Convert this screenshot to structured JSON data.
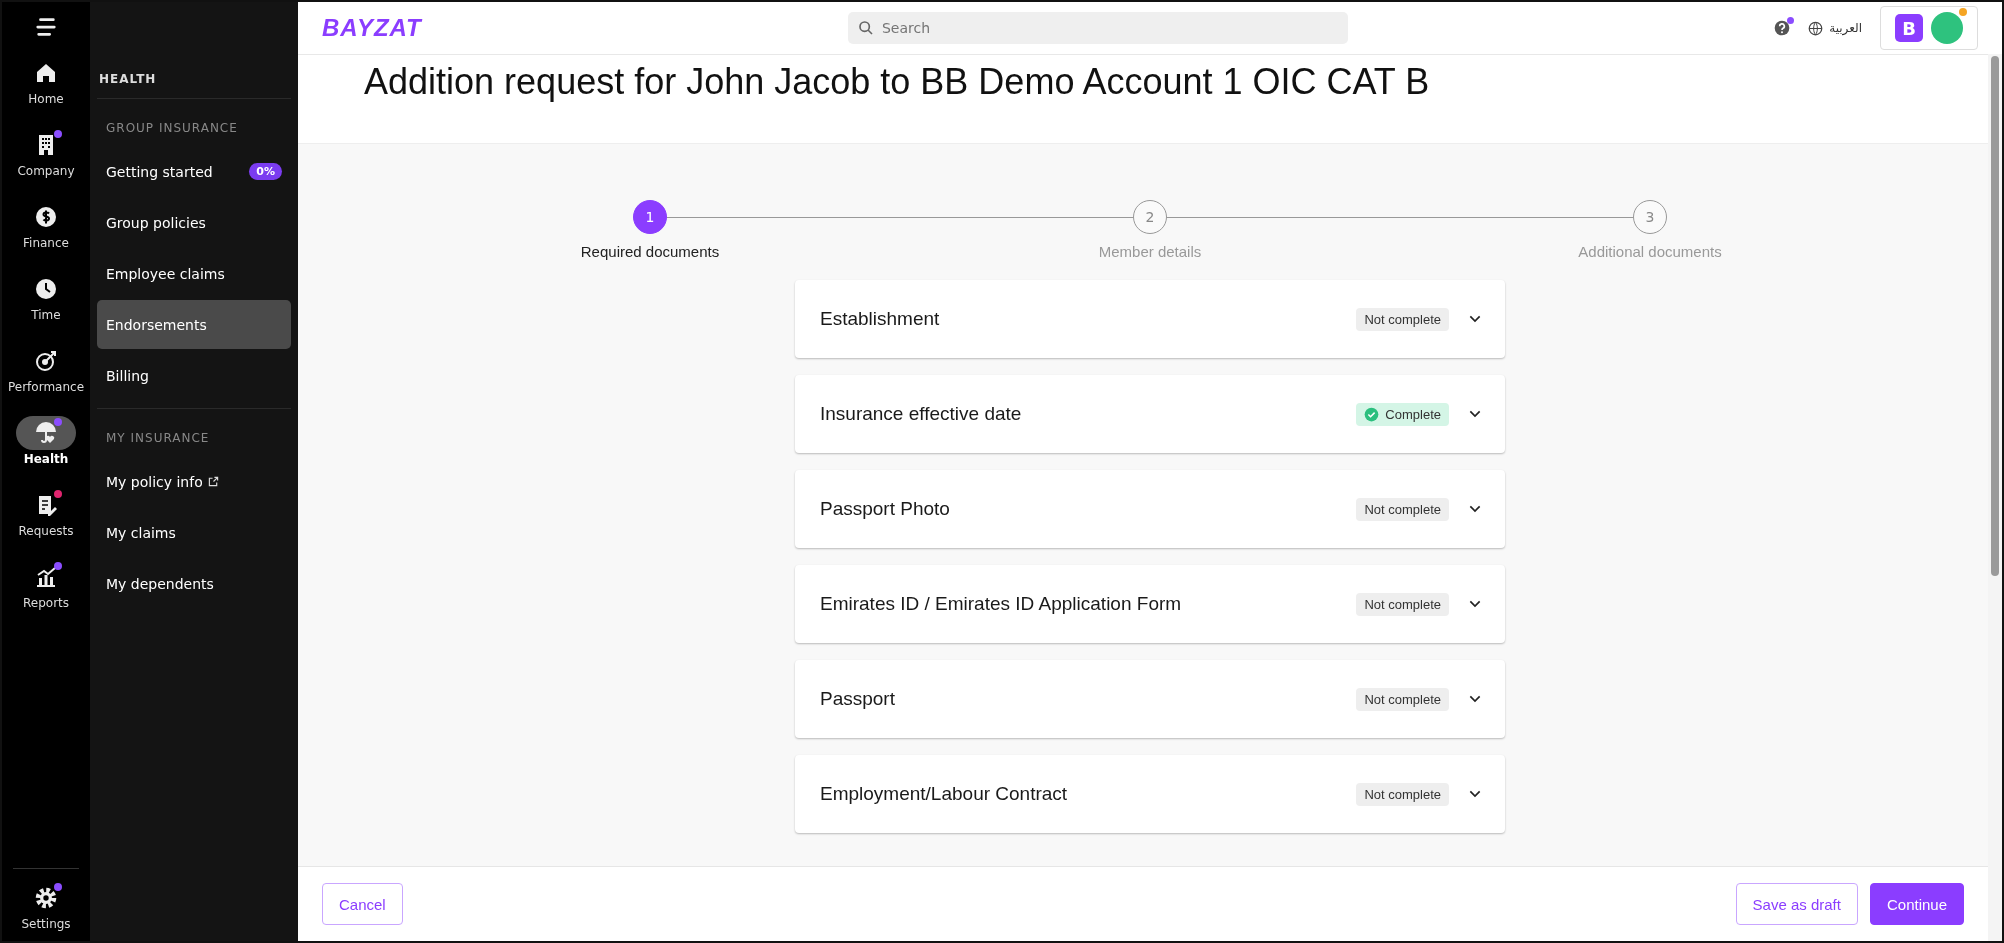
{
  "rail": {
    "items": [
      {
        "kind": "home",
        "label": "Home",
        "selected": false
      },
      {
        "kind": "company",
        "label": "Company",
        "selected": false,
        "color": "#8b4dff"
      },
      {
        "kind": "finance",
        "label": "Finance",
        "selected": false
      },
      {
        "kind": "time",
        "label": "Time",
        "selected": false
      },
      {
        "kind": "performance",
        "label": "Performance",
        "selected": false
      },
      {
        "kind": "health",
        "label": "Health",
        "selected": true,
        "color": "#8b4dff"
      },
      {
        "kind": "requests",
        "label": "Requests",
        "selected": false,
        "color": "#e0246e"
      },
      {
        "kind": "reports",
        "label": "Reports",
        "selected": false,
        "color": "#8b4dff"
      }
    ],
    "settings": {
      "label": "Settings",
      "color": "#8b4dff"
    }
  },
  "sidebar": {
    "title": "HEALTH",
    "sections": [
      {
        "heading": "GROUP INSURANCE",
        "items": [
          {
            "label": "Getting started",
            "badge": "0%",
            "selected": false
          },
          {
            "label": "Group policies",
            "selected": false
          },
          {
            "label": "Employee claims",
            "selected": false
          },
          {
            "label": "Endorsements",
            "selected": true
          },
          {
            "label": "Billing",
            "selected": false
          }
        ]
      },
      {
        "heading": "MY INSURANCE",
        "items": [
          {
            "label": "My policy info",
            "external": true,
            "selected": false
          },
          {
            "label": "My claims",
            "selected": false
          },
          {
            "label": "My dependents",
            "selected": false
          }
        ]
      }
    ]
  },
  "topbar": {
    "logo": "BAYZAT",
    "search": {
      "placeholder": "Search"
    },
    "language": "العربية",
    "company_initial": "B"
  },
  "page": {
    "title": "Addition request for John Jacob to BB Demo Account 1 OIC CAT B"
  },
  "stepper": [
    {
      "number": "1",
      "label": "Required documents",
      "selected": true
    },
    {
      "number": "2",
      "label": "Member details",
      "selected": false
    },
    {
      "number": "3",
      "label": "Additional documents",
      "selected": false
    }
  ],
  "sections": [
    {
      "title": "Establishment",
      "status": "Not complete",
      "complete": false
    },
    {
      "title": "Insurance effective date",
      "status": "Complete",
      "complete": true
    },
    {
      "title": "Passport Photo",
      "status": "Not complete",
      "complete": false
    },
    {
      "title": "Emirates ID / Emirates ID Application Form",
      "status": "Not complete",
      "complete": false
    },
    {
      "title": "Passport",
      "status": "Not complete",
      "complete": false
    },
    {
      "title": "Employment/Labour Contract",
      "status": "Not complete",
      "complete": false
    }
  ],
  "footer": {
    "cancel": "Cancel",
    "save_draft": "Save as draft",
    "continue": "Continue"
  }
}
